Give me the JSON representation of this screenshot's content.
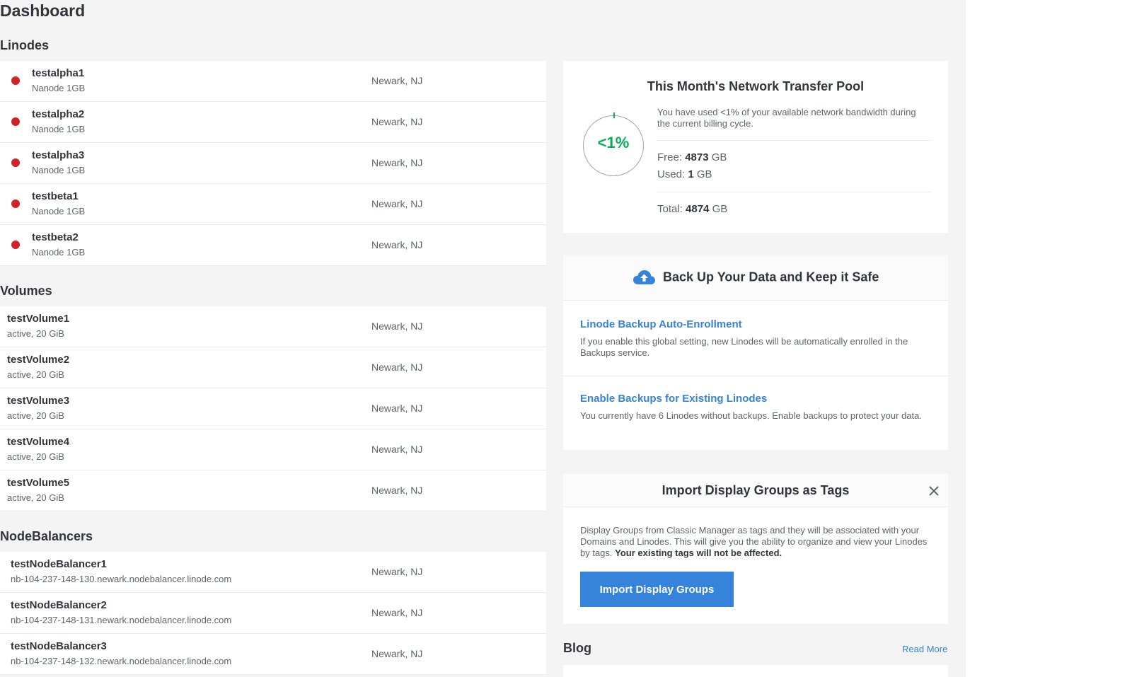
{
  "page": {
    "title": "Dashboard"
  },
  "linodes": {
    "title": "Linodes",
    "items": [
      {
        "name": "testalpha1",
        "plan": "Nanode 1GB",
        "region": "Newark, NJ",
        "status_color": "#cd2227"
      },
      {
        "name": "testalpha2",
        "plan": "Nanode 1GB",
        "region": "Newark, NJ",
        "status_color": "#cd2227"
      },
      {
        "name": "testalpha3",
        "plan": "Nanode 1GB",
        "region": "Newark, NJ",
        "status_color": "#cd2227"
      },
      {
        "name": "testbeta1",
        "plan": "Nanode 1GB",
        "region": "Newark, NJ",
        "status_color": "#cd2227"
      },
      {
        "name": "testbeta2",
        "plan": "Nanode 1GB",
        "region": "Newark, NJ",
        "status_color": "#cd2227"
      }
    ]
  },
  "volumes": {
    "title": "Volumes",
    "items": [
      {
        "name": "testVolume1",
        "status": "active, 20 GiB",
        "region": "Newark, NJ"
      },
      {
        "name": "testVolume2",
        "status": "active, 20 GiB",
        "region": "Newark, NJ"
      },
      {
        "name": "testVolume3",
        "status": "active, 20 GiB",
        "region": "Newark, NJ"
      },
      {
        "name": "testVolume4",
        "status": "active, 20 GiB",
        "region": "Newark, NJ"
      },
      {
        "name": "testVolume5",
        "status": "active, 20 GiB",
        "region": "Newark, NJ"
      }
    ]
  },
  "nodebalancers": {
    "title": "NodeBalancers",
    "items": [
      {
        "name": "testNodeBalancer1",
        "hostname": "nb-104-237-148-130.newark.nodebalancer.linode.com",
        "region": "Newark, NJ"
      },
      {
        "name": "testNodeBalancer2",
        "hostname": "nb-104-237-148-131.newark.nodebalancer.linode.com",
        "region": "Newark, NJ"
      },
      {
        "name": "testNodeBalancer3",
        "hostname": "nb-104-237-148-132.newark.nodebalancer.linode.com",
        "region": "Newark, NJ"
      }
    ]
  },
  "transfer": {
    "title": "This Month's Network Transfer Pool",
    "percent_label": "<1%",
    "description": "You have used <1% of your available network bandwidth during the current billing cycle.",
    "free_label": "Free:",
    "free_value": "4873",
    "used_label": "Used:",
    "used_value": "1",
    "total_label": "Total:",
    "total_value": "4874",
    "unit": "GB",
    "accent_color": "#00b159"
  },
  "backups": {
    "title": "Back Up Your Data and Keep it Safe",
    "icon": "cloud-upload-icon",
    "auto_enroll_link": "Linode Backup Auto-Enrollment",
    "auto_enroll_desc": "If you enable this global setting, new Linodes will be automatically enrolled in the Backups service.",
    "enable_link": "Enable Backups for Existing Linodes",
    "enable_desc": "You currently have 6 Linodes without backups. Enable backups to protect your data."
  },
  "import_groups": {
    "title": "Import Display Groups as Tags",
    "description": "Display Groups from Classic Manager as tags and they will be associated with your Domains and Linodes. This will give you the ability to organize and view your Linodes by tags.",
    "description_bold": "Your existing tags will not be affected.",
    "button_label": "Import Display Groups"
  },
  "blog": {
    "title": "Blog",
    "read_more": "Read More"
  },
  "colors": {
    "link": "#3683dc",
    "status_offline": "#cd2227",
    "background": "#f4f4f4"
  }
}
